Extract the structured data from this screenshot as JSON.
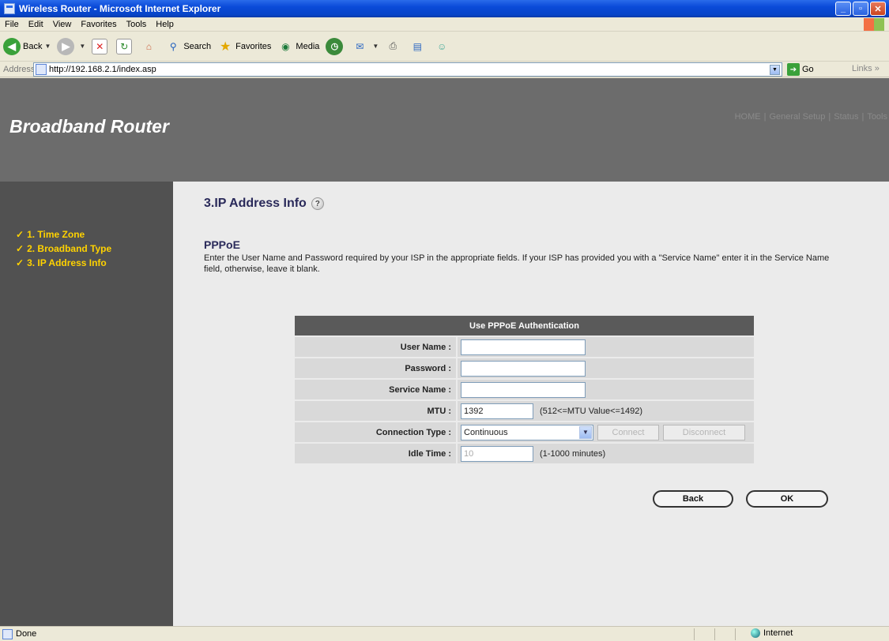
{
  "window": {
    "title": "Wireless Router - Microsoft Internet Explorer"
  },
  "menu": [
    "File",
    "Edit",
    "View",
    "Favorites",
    "Tools",
    "Help"
  ],
  "toolbar": {
    "back": "Back",
    "search": "Search",
    "favorites": "Favorites",
    "media": "Media"
  },
  "address": {
    "label": "Address",
    "url": "http://192.168.2.1/index.asp",
    "go": "Go",
    "links": "Links"
  },
  "header": {
    "brand": "Broadband Router",
    "nav": [
      "HOME",
      "General Setup",
      "Status",
      "Tools"
    ]
  },
  "sidebar": {
    "items": [
      {
        "label": "1. Time Zone"
      },
      {
        "label": "2. Broadband Type"
      },
      {
        "label": "3. IP Address Info"
      }
    ]
  },
  "main": {
    "title": "3.IP Address Info",
    "subtitle": "PPPoE",
    "description": "Enter the User Name and Password required by your ISP in the appropriate fields. If your ISP has provided you with a \"Service Name\" enter it in the Service Name field, otherwise, leave it blank."
  },
  "form": {
    "header": "Use PPPoE Authentication",
    "user_name_label": "User Name :",
    "user_name_value": "",
    "password_label": "Password :",
    "password_value": "",
    "service_name_label": "Service Name :",
    "service_name_value": "",
    "mtu_label": "MTU :",
    "mtu_value": "1392",
    "mtu_hint": "(512<=MTU Value<=1492)",
    "connection_type_label": "Connection Type :",
    "connection_type_value": "Continuous",
    "connect_label": "Connect",
    "disconnect_label": "Disconnect",
    "idle_time_label": "Idle Time :",
    "idle_time_value": "10",
    "idle_time_hint": "(1-1000 minutes)"
  },
  "buttons": {
    "back": "Back",
    "ok": "OK"
  },
  "status": {
    "text": "Done",
    "zone": "Internet"
  }
}
